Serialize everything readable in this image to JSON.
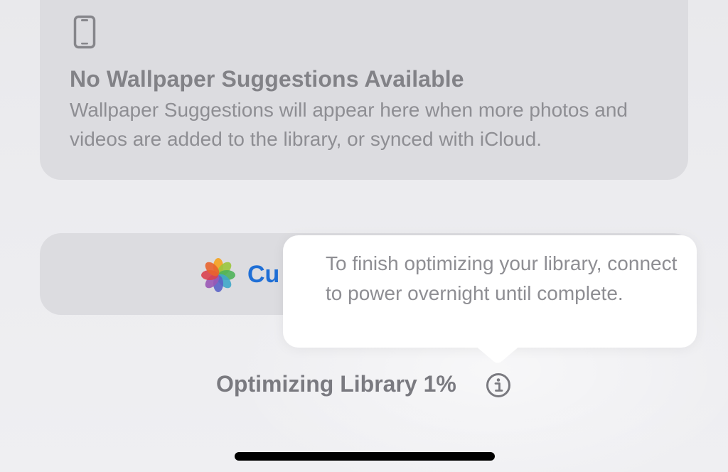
{
  "suggestions_card": {
    "title": "No Wallpaper Suggestions Available",
    "body": "Wallpaper Suggestions will appear here when more photos and videos are added to the library, or synced with iCloud.",
    "icon": "iphone-icon"
  },
  "customize_button": {
    "label": "Cu",
    "icon": "photos-app-icon",
    "label_color": "#1f6fd6"
  },
  "tooltip": {
    "text": "To finish optimizing your library, connect to power overnight until complete."
  },
  "status": {
    "text": "Optimizing Library 1%",
    "progress_percent": 1,
    "icon": "info-icon"
  }
}
